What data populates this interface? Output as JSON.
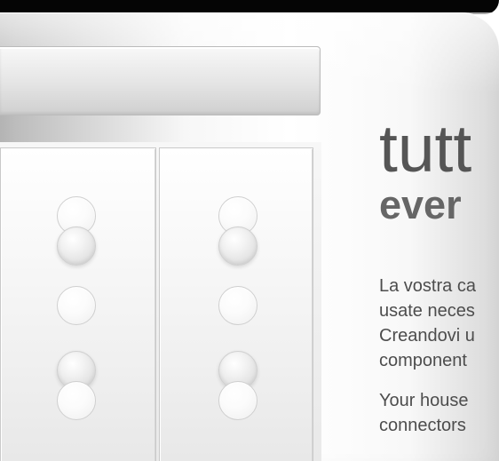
{
  "product": {
    "name": "wall control panel",
    "display_strip": {
      "type": "horizontal cover strip"
    },
    "modules": [
      {
        "name": "left socket module",
        "sockets": [
          "upper-filled",
          "middle-empty",
          "lower-filled"
        ]
      },
      {
        "name": "right socket module",
        "sockets": [
          "upper-filled",
          "middle-empty",
          "lower-filled"
        ]
      }
    ]
  },
  "headline": {
    "primary": "tutt",
    "secondary": "ever"
  },
  "body_text": {
    "italian_lines": [
      "La vostra ca",
      "usate neces",
      "Creandovi u",
      "component"
    ],
    "english_lines": [
      "Your house",
      "connectors"
    ]
  },
  "colors": {
    "background": "#ffffff",
    "top_bar": "#050505",
    "plate_light": "#f8f8f8",
    "plate_shadow": "#b7b7b7",
    "text_dark": "#444444",
    "text_mid": "#666666"
  }
}
